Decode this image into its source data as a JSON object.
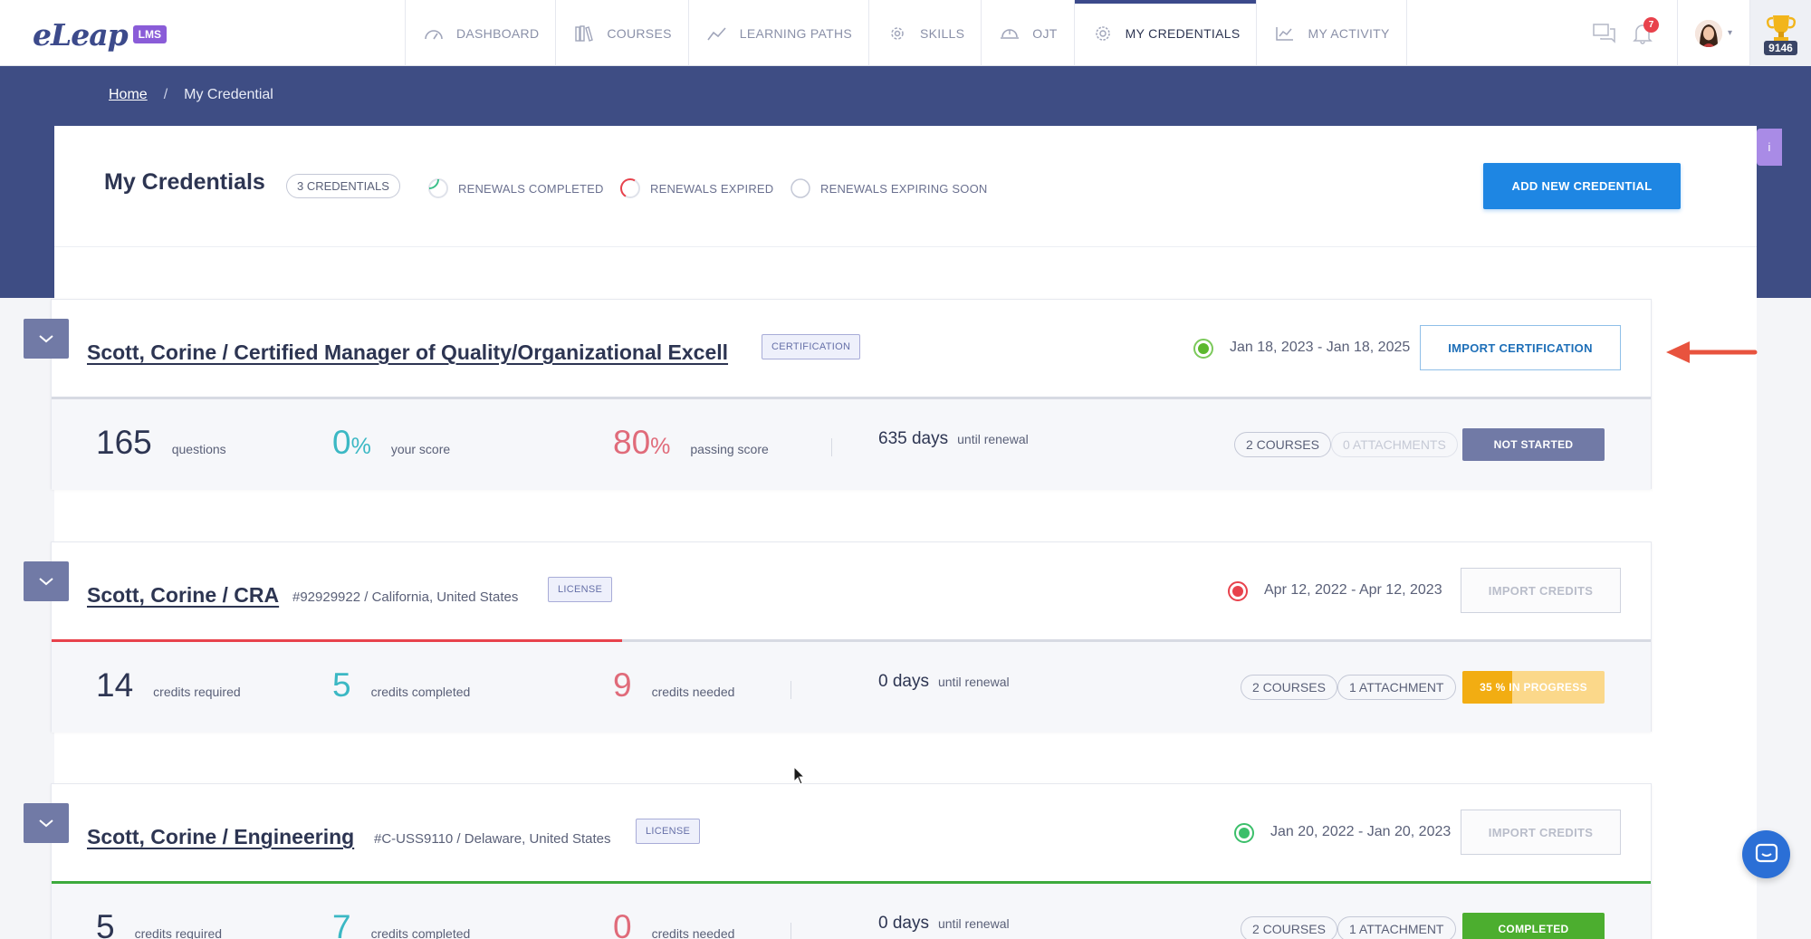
{
  "brand": {
    "logo": "eLeap",
    "badge": "LMS"
  },
  "nav": [
    {
      "label": "DASHBOARD",
      "icon": "gauge-icon"
    },
    {
      "label": "COURSES",
      "icon": "books-icon"
    },
    {
      "label": "LEARNING PATHS",
      "icon": "path-icon"
    },
    {
      "label": "SKILLS",
      "icon": "skills-icon"
    },
    {
      "label": "OJT",
      "icon": "hardhat-icon"
    },
    {
      "label": "MY CREDENTIALS",
      "icon": "badge-icon",
      "active": true
    },
    {
      "label": "MY ACTIVITY",
      "icon": "activity-chart-icon"
    }
  ],
  "topbar": {
    "notifications_count": "7",
    "points": "9146"
  },
  "breadcrumb": {
    "home": "Home",
    "separator": "/",
    "current": "My Credential"
  },
  "side_tab": "i",
  "header": {
    "title": "My Credentials",
    "count": "3 CREDENTIALS",
    "legend": [
      {
        "label": "RENEWALS COMPLETED",
        "color": "#3bbf8a"
      },
      {
        "label": "RENEWALS EXPIRED",
        "color": "#e8424c"
      },
      {
        "label": "RENEWALS EXPIRING SOON",
        "color": "#c4c8d6"
      }
    ],
    "add_button": "ADD NEW CREDENTIAL"
  },
  "credentials": [
    {
      "title": "Scott, Corine / Certified Manager of Quality/Organizational Excell",
      "subtitle": "",
      "type": "CERTIFICATION",
      "status_color": "#5cb82e",
      "dates": "Jan 18, 2023 - Jan 18, 2025",
      "import_label": "IMPORT CERTIFICATION",
      "import_enabled": true,
      "progress": 0,
      "progress_color": "#d7dae3",
      "metrics": [
        {
          "value": "165",
          "suffix": "",
          "label": "questions",
          "color": "#2d3552"
        },
        {
          "value": "0",
          "suffix": "%",
          "label": "your score",
          "color": "#3bb8c4"
        },
        {
          "value": "80",
          "suffix": "%",
          "label": "passing score",
          "color": "#e06b7a"
        }
      ],
      "days": "635 days",
      "days_label": "until renewal",
      "courses": "2 COURSES",
      "attachments": "0 ATTACHMENTS",
      "attachments_faded": true,
      "status": "NOT STARTED",
      "status_bg": "#717aa6",
      "status_progress": null
    },
    {
      "title": "Scott, Corine / CRA",
      "subtitle": "#92929922 / California, United States",
      "type": "LICENSE",
      "status_color": "#e8424c",
      "dates": "Apr 12, 2022 - Apr 12, 2023",
      "import_label": "IMPORT CREDITS",
      "import_enabled": false,
      "progress": 0.357,
      "progress_color": "#e8424c",
      "metrics": [
        {
          "value": "14",
          "suffix": "",
          "label": "credits required",
          "color": "#2d3552"
        },
        {
          "value": "5",
          "suffix": "",
          "label": "credits completed",
          "color": "#3bb8c4"
        },
        {
          "value": "9",
          "suffix": "",
          "label": "credits needed",
          "color": "#e06b7a"
        }
      ],
      "days": "0 days",
      "days_label": "until renewal",
      "courses": "2 COURSES",
      "attachments": "1 ATTACHMENT",
      "attachments_faded": false,
      "status": "35 % IN PROGRESS",
      "status_bg": "#fbd88a",
      "status_progress": 0.35
    },
    {
      "title": "Scott, Corine / Engineering",
      "subtitle": "#C-USS9110 / Delaware, United States",
      "type": "LICENSE",
      "status_color": "#3bbf6a",
      "dates": "Jan 20, 2022 - Jan 20, 2023",
      "import_label": "IMPORT CREDITS",
      "import_enabled": false,
      "progress": 1,
      "progress_color": "#3daa3d",
      "metrics": [
        {
          "value": "5",
          "suffix": "",
          "label": "credits required",
          "color": "#2d3552"
        },
        {
          "value": "7",
          "suffix": "",
          "label": "credits completed",
          "color": "#3bb8c4"
        },
        {
          "value": "0",
          "suffix": "",
          "label": "credits needed",
          "color": "#e06b7a"
        }
      ],
      "days": "0 days",
      "days_label": "until renewal",
      "courses": "2 COURSES",
      "attachments": "1 ATTACHMENT",
      "attachments_faded": false,
      "status": "COMPLETED",
      "status_bg": "#4cae2f",
      "status_progress": null
    }
  ]
}
